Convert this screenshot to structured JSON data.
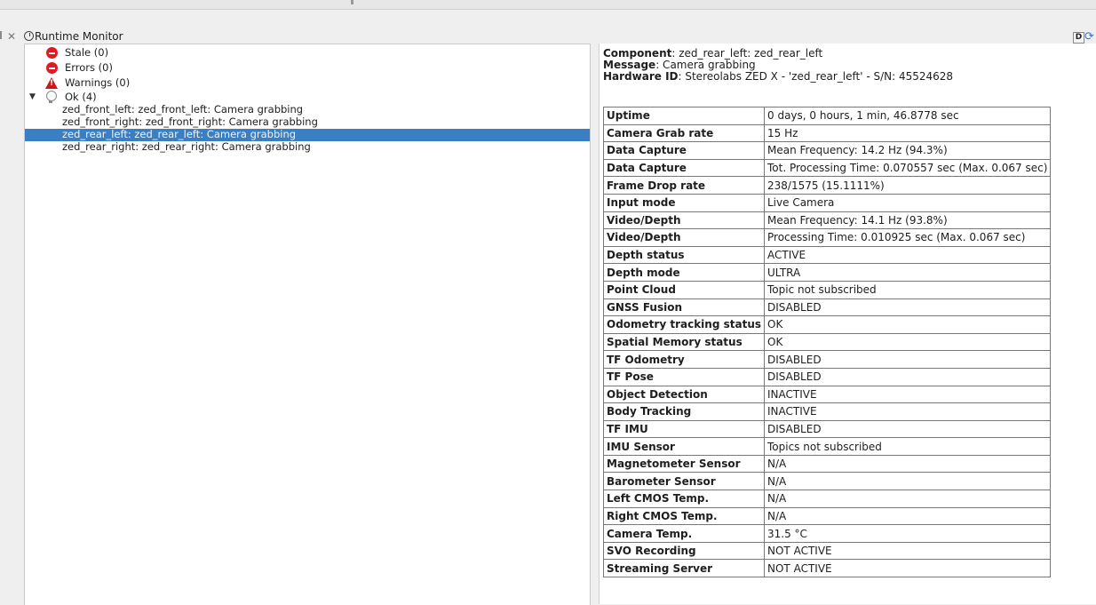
{
  "window": {
    "title": "Runtime Monitor",
    "d_button": "D"
  },
  "tree": {
    "stale": "Stale (0)",
    "errors": "Errors (0)",
    "warnings": "Warnings (0)",
    "ok": "Ok (4)",
    "items": [
      "zed_front_left: zed_front_left: Camera grabbing",
      "zed_front_right: zed_front_right: Camera grabbing",
      "zed_rear_left: zed_rear_left: Camera grabbing",
      "zed_rear_right: zed_rear_right: Camera grabbing"
    ],
    "selected_index": 2
  },
  "details": {
    "component_label": "Component",
    "component_value": ": zed_rear_left: zed_rear_left",
    "message_label": "Message",
    "message_value": ": Camera grabbing",
    "hardware_label": "Hardware ID",
    "hardware_value": ": Stereolabs ZED X - 'zed_rear_left' - S/N: 45524628",
    "rows": [
      {
        "key": "Uptime",
        "value": "0 days, 0 hours, 1 min, 46.8778 sec"
      },
      {
        "key": "Camera Grab rate",
        "value": "15 Hz"
      },
      {
        "key": "Data Capture",
        "value": "Mean Frequency: 14.2 Hz (94.3%)"
      },
      {
        "key": "Data Capture",
        "value": "Tot. Processing Time: 0.070557 sec (Max. 0.067 sec)"
      },
      {
        "key": "Frame Drop rate",
        "value": "238/1575 (15.1111%)"
      },
      {
        "key": "Input mode",
        "value": "Live Camera"
      },
      {
        "key": "Video/Depth",
        "value": "Mean Frequency: 14.1 Hz (93.8%)"
      },
      {
        "key": "Video/Depth",
        "value": "Processing Time: 0.010925 sec (Max. 0.067 sec)"
      },
      {
        "key": "Depth status",
        "value": "ACTIVE"
      },
      {
        "key": "Depth mode",
        "value": "ULTRA"
      },
      {
        "key": "Point Cloud",
        "value": "Topic not subscribed"
      },
      {
        "key": "GNSS Fusion",
        "value": "DISABLED"
      },
      {
        "key": "Odometry tracking status",
        "value": "OK"
      },
      {
        "key": "Spatial Memory status",
        "value": "OK"
      },
      {
        "key": "TF Odometry",
        "value": "DISABLED"
      },
      {
        "key": "TF Pose",
        "value": "DISABLED"
      },
      {
        "key": "Object Detection",
        "value": "INACTIVE"
      },
      {
        "key": "Body Tracking",
        "value": "INACTIVE"
      },
      {
        "key": "TF IMU",
        "value": "DISABLED"
      },
      {
        "key": "IMU Sensor",
        "value": "Topics not subscribed"
      },
      {
        "key": "Magnetometer Sensor",
        "value": "N/A"
      },
      {
        "key": "Barometer Sensor",
        "value": "N/A"
      },
      {
        "key": "Left CMOS Temp.",
        "value": "N/A"
      },
      {
        "key": "Right CMOS Temp.",
        "value": "N/A"
      },
      {
        "key": "Camera Temp.",
        "value": "31.5 °C"
      },
      {
        "key": "SVO Recording",
        "value": "NOT ACTIVE"
      },
      {
        "key": "Streaming Server",
        "value": "NOT ACTIVE"
      }
    ]
  },
  "colors": {
    "selection": "#3a7fc4",
    "error_red": "#e01b24"
  },
  "icons": {
    "stale": "stop-icon",
    "errors": "stop-icon",
    "warnings": "warning-triangle-icon",
    "ok": "lightbulb-icon",
    "title": "monitor-power-icon",
    "close": "close-icon",
    "refresh": "refresh-icon"
  }
}
